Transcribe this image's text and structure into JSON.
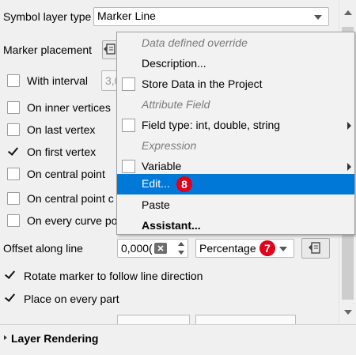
{
  "symbol_layer_type": {
    "label": "Symbol layer type",
    "value": "Marker Line"
  },
  "marker_placement": {
    "label": "Marker placement"
  },
  "interval": {
    "label": "With interval",
    "value": "3,0"
  },
  "options": [
    {
      "label": "On inner vertices",
      "checked": false
    },
    {
      "label": "On last vertex",
      "checked": false
    },
    {
      "label": "On first vertex",
      "checked": true
    },
    {
      "label": "On central point",
      "checked": false
    },
    {
      "label": "On central point c",
      "checked": false
    },
    {
      "label": "On every curve po",
      "checked": false
    }
  ],
  "offset": {
    "label": "Offset along line",
    "value": "0,000(",
    "unit": "Percentage",
    "badge": "7"
  },
  "rotate": {
    "label": "Rotate marker to follow line direction",
    "checked": true
  },
  "every_part": {
    "label": "Place on every part",
    "checked": true
  },
  "section": {
    "label": "Layer Rendering"
  },
  "menu": {
    "items": [
      {
        "label": "Data defined override",
        "disabled": true
      },
      {
        "label": "Description..."
      },
      {
        "label": "Store Data in the Project",
        "checkbox": true
      },
      {
        "label": "Attribute Field",
        "disabled": true
      },
      {
        "label": "Field type: int, double, string",
        "checkbox": true,
        "submenu": true
      },
      {
        "label": "Expression",
        "disabled": true
      },
      {
        "label": "Variable",
        "checkbox": true,
        "submenu": true
      },
      {
        "label": "Edit...",
        "highlighted": true,
        "badge": "8"
      },
      {
        "label": "Paste"
      },
      {
        "label": "Assistant...",
        "bold": true
      }
    ]
  },
  "colors": {
    "highlight": "#0078d7",
    "badge": "#e0001a"
  }
}
